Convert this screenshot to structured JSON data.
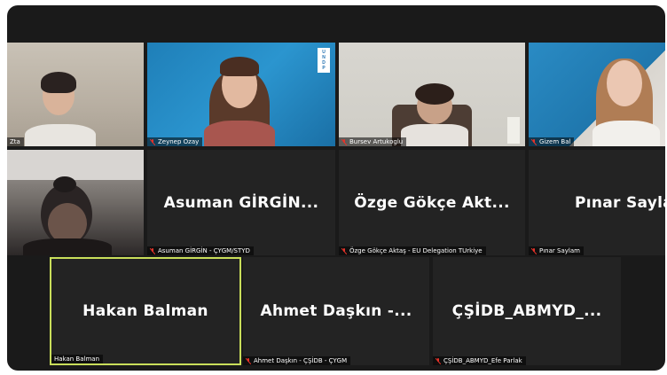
{
  "row1": [
    {
      "name": "Zta",
      "muted": false
    },
    {
      "name": "Zeynep Ozay",
      "muted": true,
      "logo_lines": [
        "U",
        "N",
        "D",
        "P"
      ]
    },
    {
      "name": "Bursev Artukoglu",
      "muted": true
    },
    {
      "name": "Gizem Bal",
      "muted": true
    }
  ],
  "row2": [
    {
      "name": "",
      "muted": false
    },
    {
      "display": "Asuman GİRGİN...",
      "name": "Asuman GİRGİN - ÇYGM/STYD",
      "muted": true
    },
    {
      "display": "Özge Gökçe Akt...",
      "name": "Özge Gökçe Aktaş - EU Delegation TUrkiye",
      "muted": true
    },
    {
      "display": "Pınar Saylam",
      "name": "Pınar Saylam",
      "muted": true
    }
  ],
  "row3": [
    {
      "display": "Hakan Balman",
      "name": "Hakan Balman",
      "muted": false,
      "active": true
    },
    {
      "display": "Ahmet Daşkın -...",
      "name": "Ahmet Daşkın - ÇŞİDB - ÇYGM",
      "muted": true
    },
    {
      "display": "ÇŞİDB_ABMYD_...",
      "name": "ÇŞİDB_ABMYD_Efe Parlak",
      "muted": true
    }
  ],
  "colors": {
    "active_border": "#c9de5a",
    "muted_icon": "#e5332a",
    "tile_bg": "#232323",
    "window_bg": "#1a1a1a"
  }
}
